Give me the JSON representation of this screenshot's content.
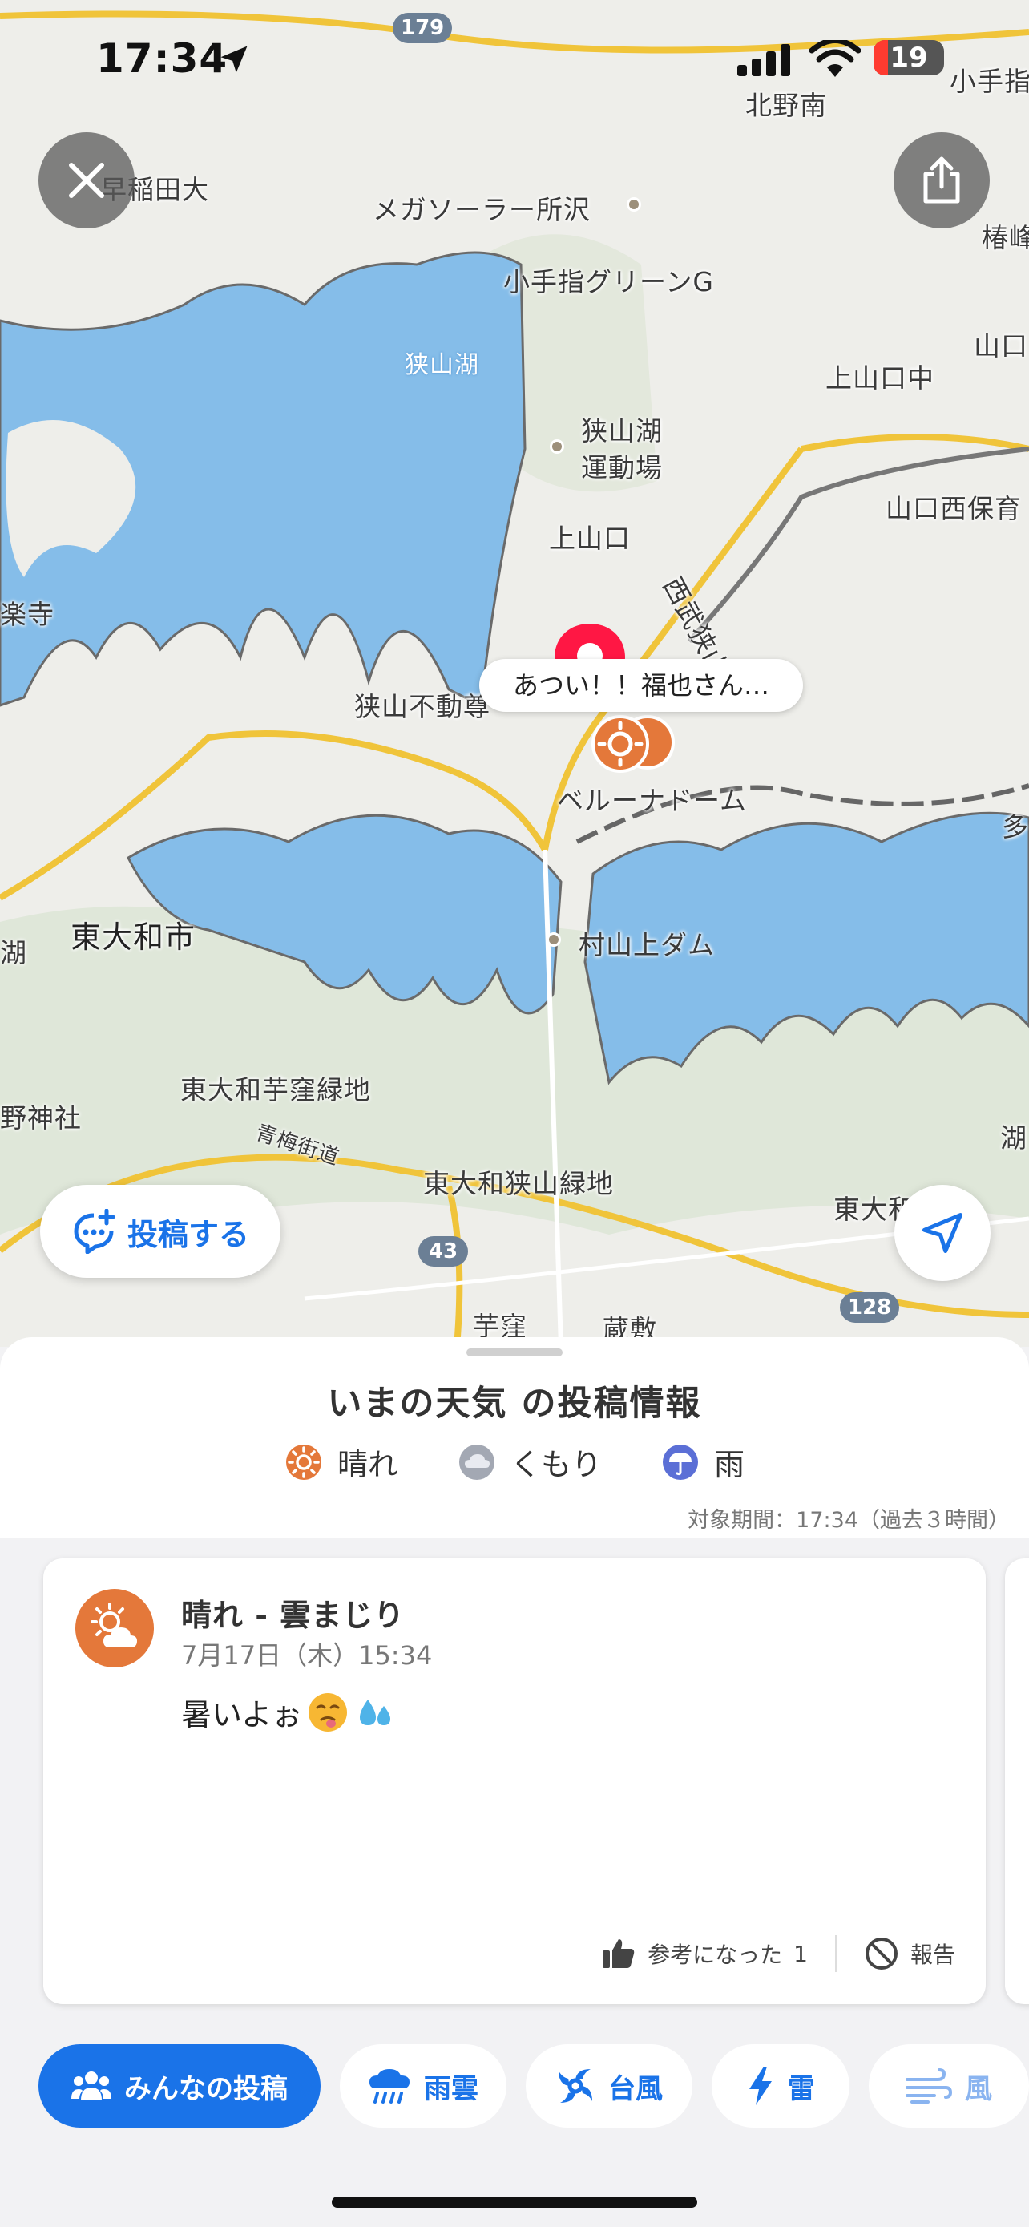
{
  "status_bar": {
    "time": "17:34",
    "battery": "19",
    "icons": [
      "location-arrow-icon",
      "signal-icon",
      "wifi-icon",
      "battery-icon"
    ]
  },
  "map": {
    "labels": {
      "kitanominami": "北野南",
      "kotesashi_top": "小手指",
      "waseda": "早稲田大",
      "megasolar": "メガソーラー所沢",
      "kotesashi_green": "小手指グリーンG",
      "tsubaki": "椿峰",
      "sayamako": "狭山湖",
      "kamiyamaguchi_jh": "上山口中",
      "yamaguchi_top": "山口",
      "sayamako_ground": "狭山湖\n運動場",
      "yamaguchi_nishi": "山口西保育",
      "kamiyamaguchi": "上山口",
      "seibu_sayama": "西武狭山線",
      "rakuji": "楽寺",
      "sayama_fudo": "狭山不動尊",
      "belluna": "ベルーナドーム",
      "higashiyamato": "東大和市",
      "murayama_dam": "村山上ダム",
      "ko": "湖",
      "imokubo_green": "東大和芋窪緑地",
      "yajinja": "野神社",
      "oume": "青梅街道",
      "sayama_green": "東大和狭山緑地",
      "higashiyamato_right": "東大和",
      "imokubo": "芋窪",
      "kurashiki": "蔵敷",
      "ko_right": "湖",
      "ta_right": "多"
    },
    "routes": [
      "179",
      "43",
      "128"
    ],
    "callout": "あつい！！福也さん…",
    "colors": {
      "water": "#85bde9",
      "land": "#eeeeea",
      "green": "#dde6d6",
      "road_major": "#f0c43a",
      "rail": "#666666"
    }
  },
  "buttons": {
    "close": "close-icon",
    "share": "share-icon",
    "post_label": "投稿する",
    "locate": "location-arrow-icon"
  },
  "sheet": {
    "title": "いまの天気 の投稿情報",
    "legend": [
      {
        "label": "晴れ",
        "icon": "sun-icon",
        "color": "#e4783a"
      },
      {
        "label": "くもり",
        "icon": "cloud-icon",
        "color": "#a3a8b3"
      },
      {
        "label": "雨",
        "icon": "umbrella-icon",
        "color": "#5b6fd6"
      }
    ],
    "period": "対象期間：17:34（過去３時間）"
  },
  "card": {
    "weather": "晴れ - 雲まじり",
    "date": "7月17日（木）15:34",
    "body": "暑いよぉ",
    "emojis": [
      "hot-face-icon",
      "sweat-droplets-icon"
    ],
    "helpful_label": "参考になった",
    "helpful_count": "1",
    "report_label": "報告"
  },
  "tabs": [
    {
      "label": "みんなの投稿",
      "icon": "people-icon",
      "active": true
    },
    {
      "label": "雨雲",
      "icon": "rain-cloud-icon"
    },
    {
      "label": "台風",
      "icon": "typhoon-icon"
    },
    {
      "label": "雷",
      "icon": "lightning-icon"
    },
    {
      "label": "風",
      "icon": "wind-icon"
    }
  ]
}
